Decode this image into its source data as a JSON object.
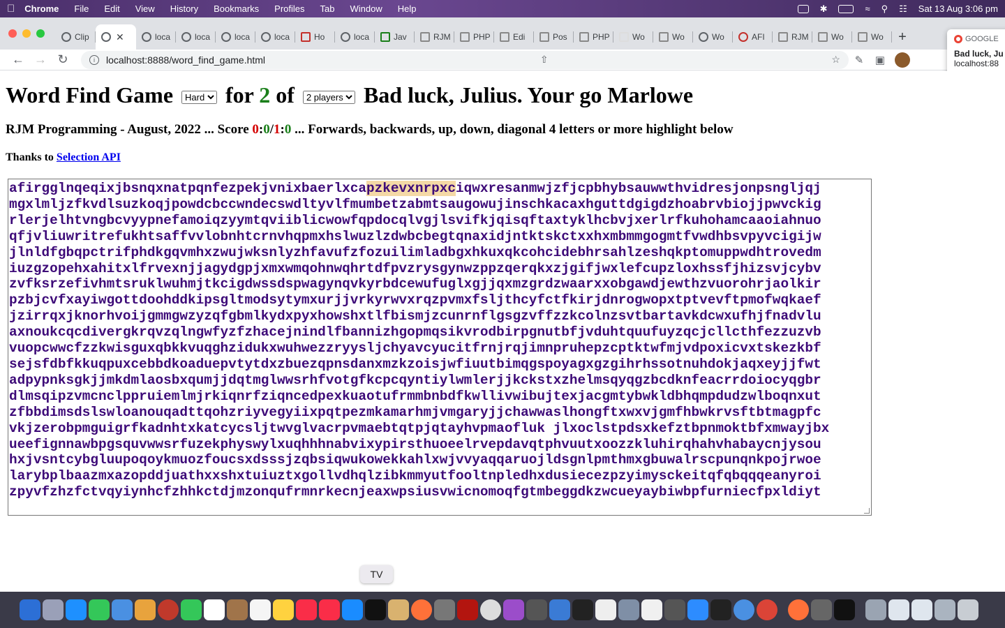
{
  "menubar": {
    "app": "Chrome",
    "items": [
      "File",
      "Edit",
      "View",
      "History",
      "Bookmarks",
      "Profiles",
      "Tab",
      "Window",
      "Help"
    ],
    "datetime": "Sat 13 Aug  3:06 pm"
  },
  "tabs": [
    "Clip",
    "",
    "loca",
    "loca",
    "loca",
    "loca",
    "Ho",
    "loca",
    "Jav",
    "RJM",
    "PHP",
    "Edi",
    "Pos",
    "PHP",
    "Wo",
    "Wo",
    "Wo",
    "AFI",
    "RJM",
    "Wo",
    "Wo"
  ],
  "toolbar": {
    "url": "localhost:8888/word_find_game.html"
  },
  "popup": {
    "source": "GOOGLE",
    "title": "Bad luck, Ju",
    "subtitle": "localhost:88"
  },
  "game": {
    "title": "Word Find Game",
    "difficulty": "Hard",
    "for_label": "for",
    "current_player": "2",
    "of_label": "of",
    "players_select": "2 players",
    "message": "Bad luck, Julius. Your go Marlowe",
    "subtitle_prefix": "RJM Programming - August, 2022 ... Score ",
    "score_a": "0",
    "score_sep1": ":",
    "score_b": "0",
    "score_slash": "/",
    "score_c": "1",
    "score_sep2": ":",
    "score_d": "0",
    "subtitle_suffix": " ... Forwards, backwards, up, down, diagonal 4 letters or more highlight below",
    "thanks_prefix": "Thanks to ",
    "thanks_link": "Selection API",
    "grid_first_pre": "afirgglnqeqixjbsnqxnatpqnfezpekjvnixbaerlxca",
    "grid_first_hl": "pzkevxnrpxc",
    "grid_first_post": "iqwxresanmwjzfjcpbhybsauwwthvidresjonpsngljqj",
    "grid_rows": [
      "mgxlmljzfkvdlsuzkoqjpowdcbccwndecswdltyvlfmumbetzabmtsaugowujinschkacaxhguttdgigdzhoabrvbiojjpwvckig",
      "rlerjelhtvngbcvyypnefamoiqzyymtqviiblicwowfqpdocqlvgjlsvifkjqisqftaxtyklhcbvjxerlrfkuhohamcaaoiahnuo",
      "qfjvliuwritrefukhtsaffvvlobnhtcrnvhqpmxhslwuzlzdwbcbegtqnaxidjntktskctxxhxmbmmgogmtfvwdhbsvpyvcigijw",
      "jlnldfgbqpctrifphdkgqvmhxzwujwksnlyzhfavufzfozuilimladbgxhkuxqkcohcidebhrsahlzeshqkptomuppwdhtrovedm",
      "iuzgzopehxahitxlfrvexnjjagydgpjxmxwmqohnwqhrtdfpvzrysgynwzppzqerqkxzjgifjwxlefcupzloxhssfjhizsvjcybv",
      "zvfksrzefivhmtsruklwuhmjtkcigdwssdspwagynqvkyrbdcewufuglxgjjqxmzgrdzwaarxxobgawdjewthzvuorohrjaolkir",
      "pzbjcvfxayiwgottdoohddkipsgltmodsytymxurjjvrkyrwvxrqzpvmxfsljthcyfctfkirjdnrogwopxtptvevftpmofwqkaef",
      "jzirrqxjknorhvoijgmmgwzyzqfgbmlkydxpyxhowshxtlfbismjzcunrnflgsgzvffzzkcolnzsvtbartavkdcwxufhjfnadvlu",
      "axnoukcqcdivergkrqvzqlngwfyzfzhacejnindlfbannizhgopmqsikvrodbirpgnutbfjvduhtquufuyzqcjcllcthfezzuzvb",
      "vuopcwwcfzzkwisguxqbkkvuqghzidukxwuhwezzryysljchyavcyucitfrnjrqjimnpruhepzcptktwfmjvdpoxicvxtskezkbf",
      "sejsfdbfkkuqpuxcebbdkoaduepvtytdxzbuezqpnsdanxmzkzoisjwfiuutbimqgspoyagxgzgihrhssotnuhdokjaqxeyjjfwt",
      "adpypnksgkjjmkdmlaosbxqumjjdqtmglwwsrhfvotgfkcpcqyntiylwmlerjjkckstxzhelmsqyqgzbcdknfeacrrdoiocyqgbr",
      "dlmsqipzvmcnclppruiemlmjrkiqnrfziqncedpexkuaotufrmmbnbdfkwllivwibujtexjacgmtybwkldbhqmpdudzwlboqnxut",
      "zfbbdimsdslswloanouqadttqohzriyvegyiixpqtpezmkamarhmjvmgaryjjchawwaslhongftxwxvjgmfhbwkrvsftbtmagpfc",
      "vkjzerobpmguigrfkadnhtxkatcycsljtwvglvacrpvmaebtqtpjqtayhvpmaofluk jlxoclstpdsxkefztbpnmoktbfxmwayjbx",
      "ueefignnawbpgsquvwwsrfuzekphyswylxuqhhhnabvixypirsthuoeelrvepdavqtphvuutxoozzkluhirqhahvhabaycnjysou",
      "hxjvsntcybgluupoqoykmuozfoucsxdsssjzqbsiqwukowekkahlxwjvvyaqqaruojldsgnlpmthmxgbuwalrscpunqnkpojrwoe",
      "larybplbaazmxazopddjuathxxshxtuiuztxgollvdhqlzibkmmyutfooltnpledhxdusiecezpzyimysckeitqfqbqqqeanyroi",
      "zpyvfzhzfctvqyiynhcfzhhkctdjmzonqufrmnrkecnjeaxwpsiusvwicnomoqfgtmbeggdkzwcueyaybiwbpfurniecfpxldiyt"
    ]
  },
  "dock": {
    "tooltip": "TV"
  }
}
